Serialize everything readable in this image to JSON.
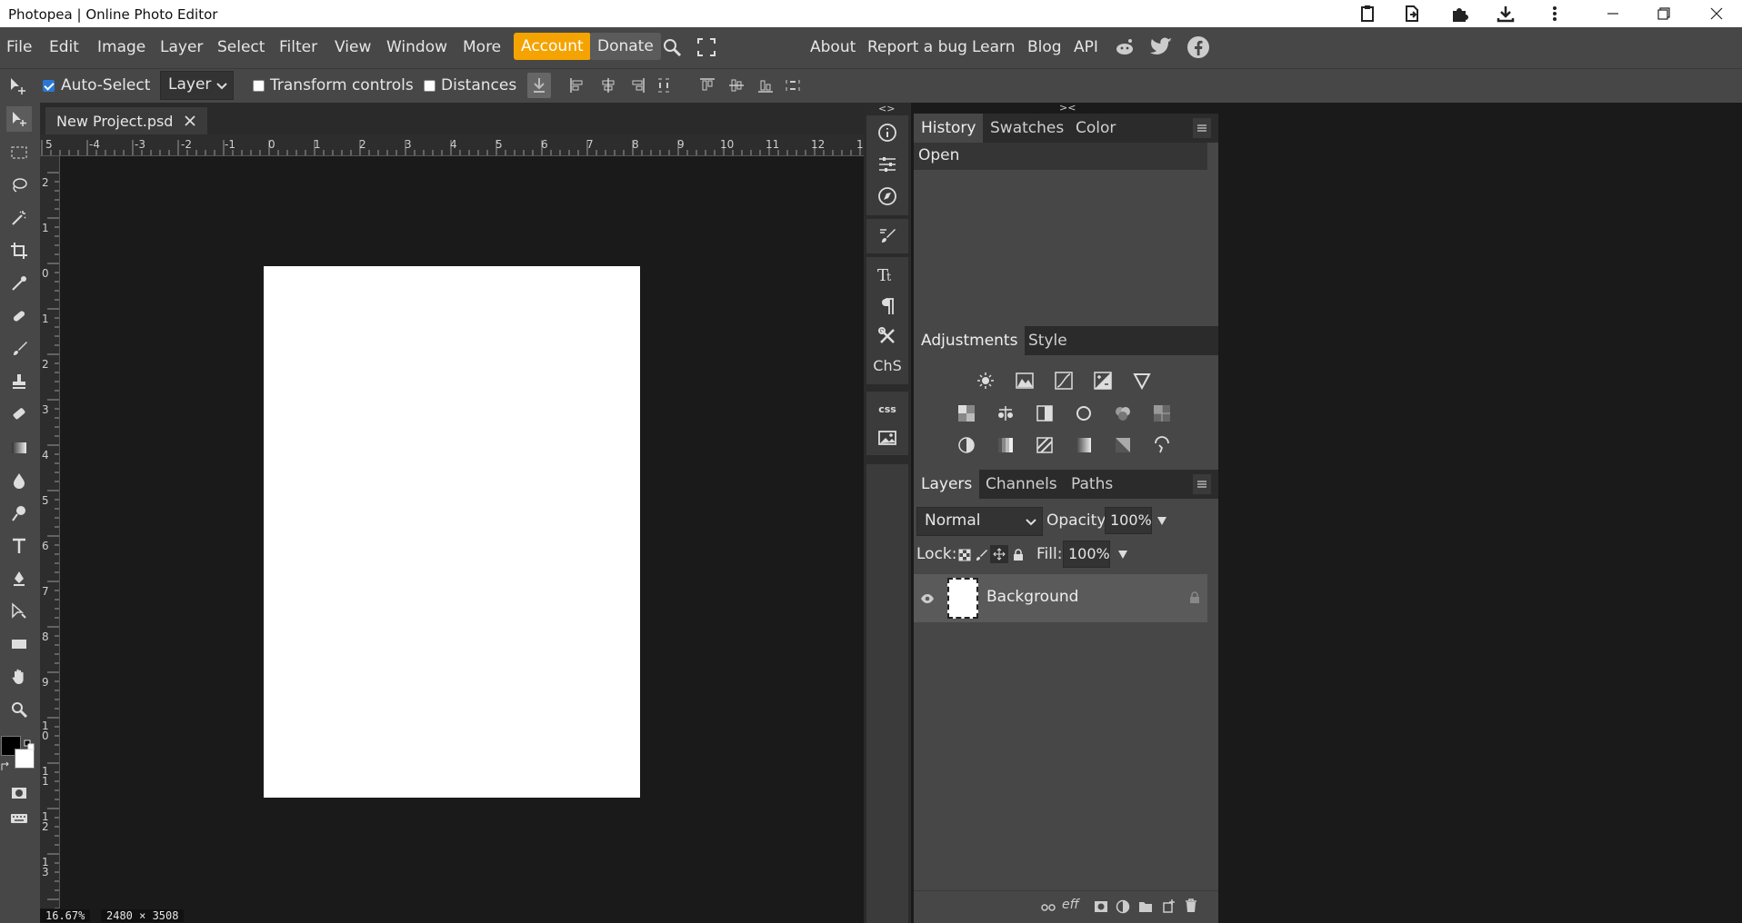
{
  "window": {
    "title": "Photopea | Online Photo Editor"
  },
  "menu": {
    "items": [
      "File",
      "Edit",
      "Image",
      "Layer",
      "Select",
      "Filter",
      "View",
      "Window",
      "More"
    ],
    "account": "Account",
    "donate": "Donate",
    "right_links": [
      "About",
      "Report a bug",
      "Learn",
      "Blog",
      "API"
    ]
  },
  "options": {
    "auto_select_label": "Auto-Select",
    "auto_select_checked": true,
    "layer_select_value": "Layer",
    "transform_label": "Transform controls",
    "distances_label": "Distances"
  },
  "document": {
    "tab_name": "New Project.psd",
    "zoom": "16.67%",
    "size": "2480 × 3508"
  },
  "ruler": {
    "top_labels": [
      "5",
      "-4",
      "-3",
      "-2",
      "-1",
      "0",
      "1",
      "2",
      "3",
      "4",
      "5",
      "6",
      "7",
      "8",
      "9",
      "10",
      "11",
      "12",
      "1"
    ],
    "left_labels": [
      "2",
      "1",
      "0",
      "1",
      "2",
      "3",
      "4",
      "5",
      "6",
      "7",
      "8",
      "9",
      "1\n0",
      "1\n1",
      "1\n2",
      "1\n3"
    ]
  },
  "mini_panel": {
    "chs_label": "ChS",
    "css_label": "CSS"
  },
  "history_panel": {
    "tabs": [
      "History",
      "Swatches",
      "Color"
    ],
    "entries": [
      "Open"
    ]
  },
  "adjustments_panel": {
    "tabs": [
      "Adjustments",
      "Style"
    ]
  },
  "layers_panel": {
    "tabs": [
      "Layers",
      "Channels",
      "Paths"
    ],
    "blend_mode": "Normal",
    "opacity_label": "Opacity:",
    "opacity_value": "100%",
    "lock_label": "Lock:",
    "fill_label": "Fill:",
    "fill_value": "100%",
    "layers": [
      {
        "name": "Background",
        "locked": true,
        "visible": true
      }
    ],
    "footer_eff": "eff"
  },
  "colors": {
    "accent": "#f5a300",
    "panel_bg": "#474747",
    "dark_bg": "#1a1a1a"
  }
}
